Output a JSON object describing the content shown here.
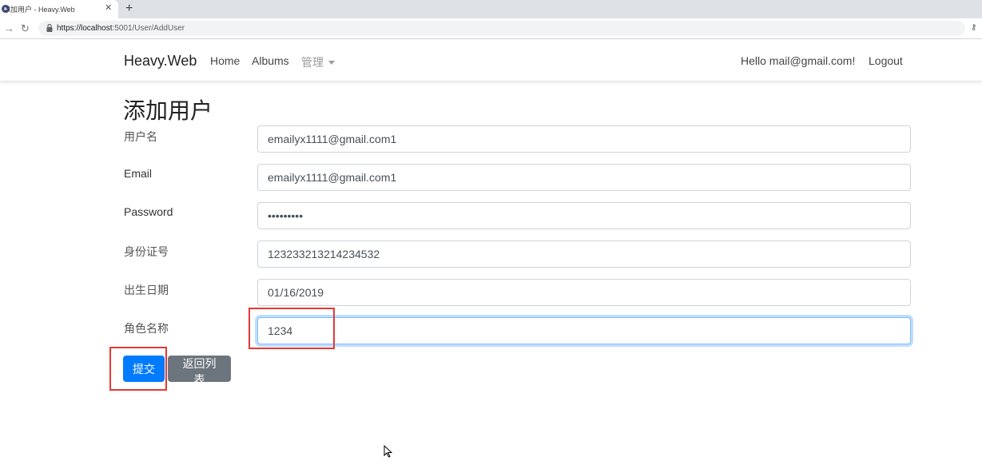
{
  "browser": {
    "tab_title": "添加用户 - Heavy.Web",
    "tab_close": "✕",
    "new_tab": "+",
    "url_host": "https://localhost",
    "url_path": ":5001/User/AddUser",
    "back_icon": "→",
    "reload_icon": "↻",
    "key_icon": "⚷"
  },
  "navbar": {
    "brand": "Heavy.Web",
    "links": [
      "Home",
      "Albums"
    ],
    "dropdown_label": "管理",
    "greeting": "Hello mail@gmail.com!",
    "logout": "Logout"
  },
  "form": {
    "title": "添加用户",
    "fields": [
      {
        "label": "用户名",
        "value": "emailyx1111@gmail.com1"
      },
      {
        "label": "Email",
        "value": "emailyx1111@gmail.com1"
      },
      {
        "label": "Password",
        "value": "•••••••••"
      },
      {
        "label": "身份证号",
        "value": "123233213214234532"
      },
      {
        "label": "出生日期",
        "value": "01/16/2019"
      },
      {
        "label": "角色名称",
        "value": "1234"
      }
    ],
    "submit_label": "提交",
    "back_label": "返回列表"
  },
  "colors": {
    "primary": "#007bff",
    "secondary": "#6c757d",
    "highlight": "#e53935"
  }
}
